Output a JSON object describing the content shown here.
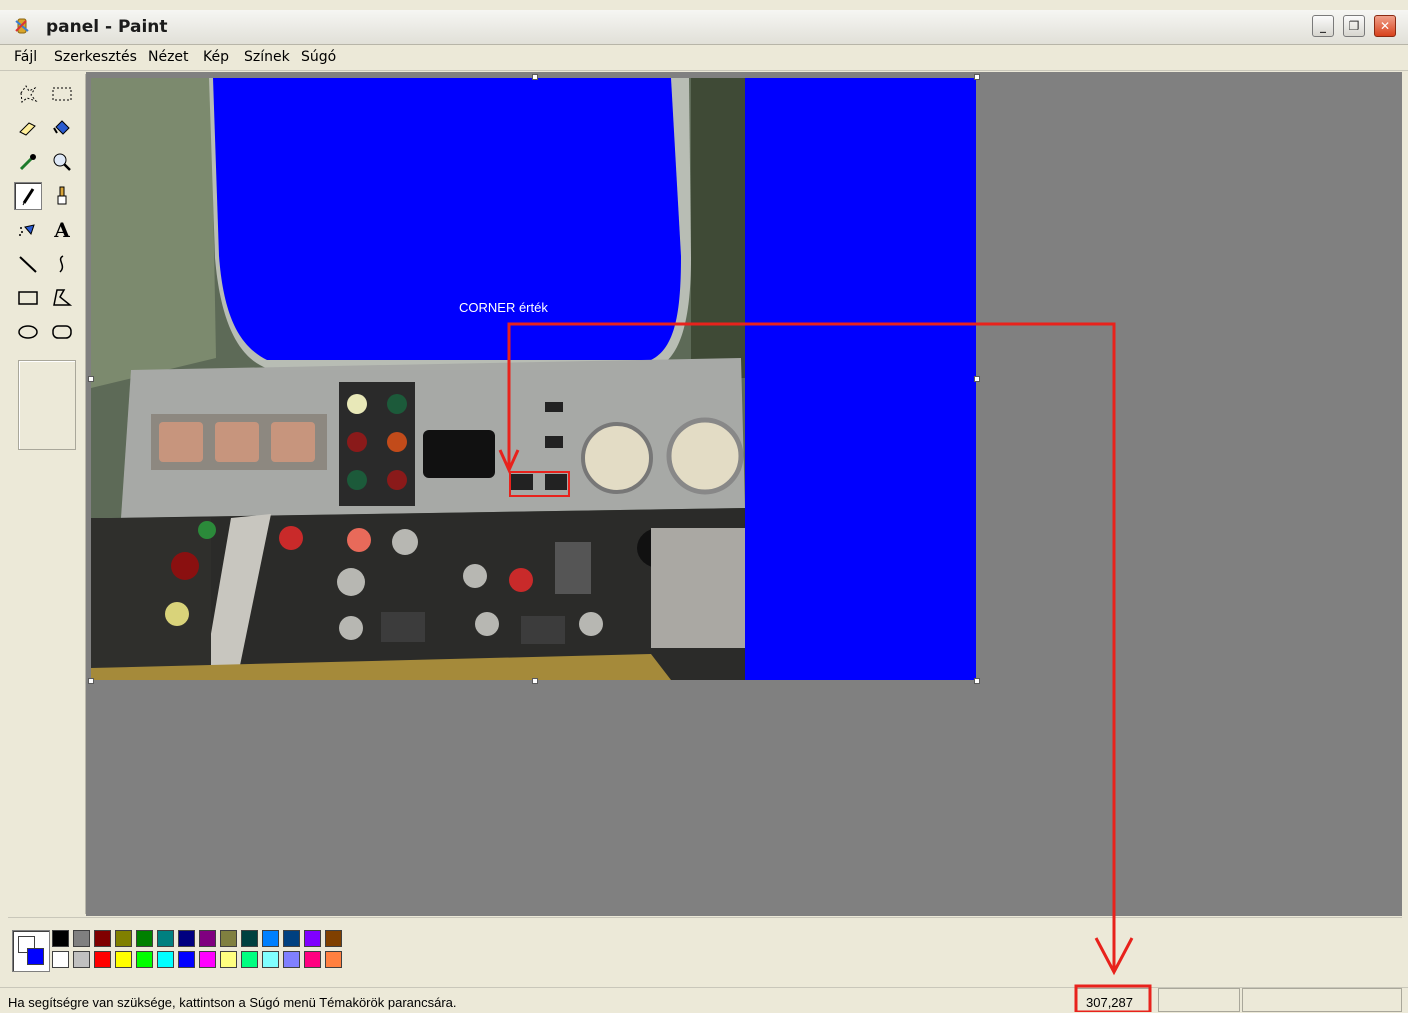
{
  "window": {
    "title": "panel - Paint"
  },
  "menu": {
    "items": [
      "Fájl",
      "Szerkesztés",
      "Nézet",
      "Kép",
      "Színek",
      "Súgó"
    ]
  },
  "tools": [
    {
      "icon": "free-select-icon"
    },
    {
      "icon": "rect-select-icon"
    },
    {
      "icon": "eraser-icon"
    },
    {
      "icon": "fill-icon"
    },
    {
      "icon": "color-picker-icon"
    },
    {
      "icon": "magnifier-icon"
    },
    {
      "icon": "pencil-icon",
      "active": true
    },
    {
      "icon": "brush-icon"
    },
    {
      "icon": "airbrush-icon"
    },
    {
      "icon": "text-icon"
    },
    {
      "icon": "line-icon"
    },
    {
      "icon": "curve-icon"
    },
    {
      "icon": "rectangle-icon"
    },
    {
      "icon": "polygon-icon"
    },
    {
      "icon": "ellipse-icon"
    },
    {
      "icon": "rounded-rect-icon"
    }
  ],
  "canvas": {
    "annotation": "CORNER érték",
    "background_color": "#0000ff"
  },
  "palette": {
    "foreground": "#ffffff",
    "background": "#0000ff",
    "row1": [
      "#000000",
      "#808080",
      "#800000",
      "#808000",
      "#008000",
      "#008080",
      "#000080",
      "#800080",
      "#808040",
      "#004040",
      "#0080ff",
      "#004080",
      "#8000ff",
      "#804000"
    ],
    "row2": [
      "#ffffff",
      "#c0c0c0",
      "#ff0000",
      "#ffff00",
      "#00ff00",
      "#00ffff",
      "#0000ff",
      "#ff00ff",
      "#ffff80",
      "#00ff80",
      "#80ffff",
      "#8080ff",
      "#ff0080",
      "#ff8040"
    ]
  },
  "status": {
    "help_text": "Ha segítségre van szüksége, kattintson a Súgó menü Témakörök parancsára.",
    "coords": "307,287"
  },
  "accent": {
    "annotation_color": "#e8221c"
  }
}
